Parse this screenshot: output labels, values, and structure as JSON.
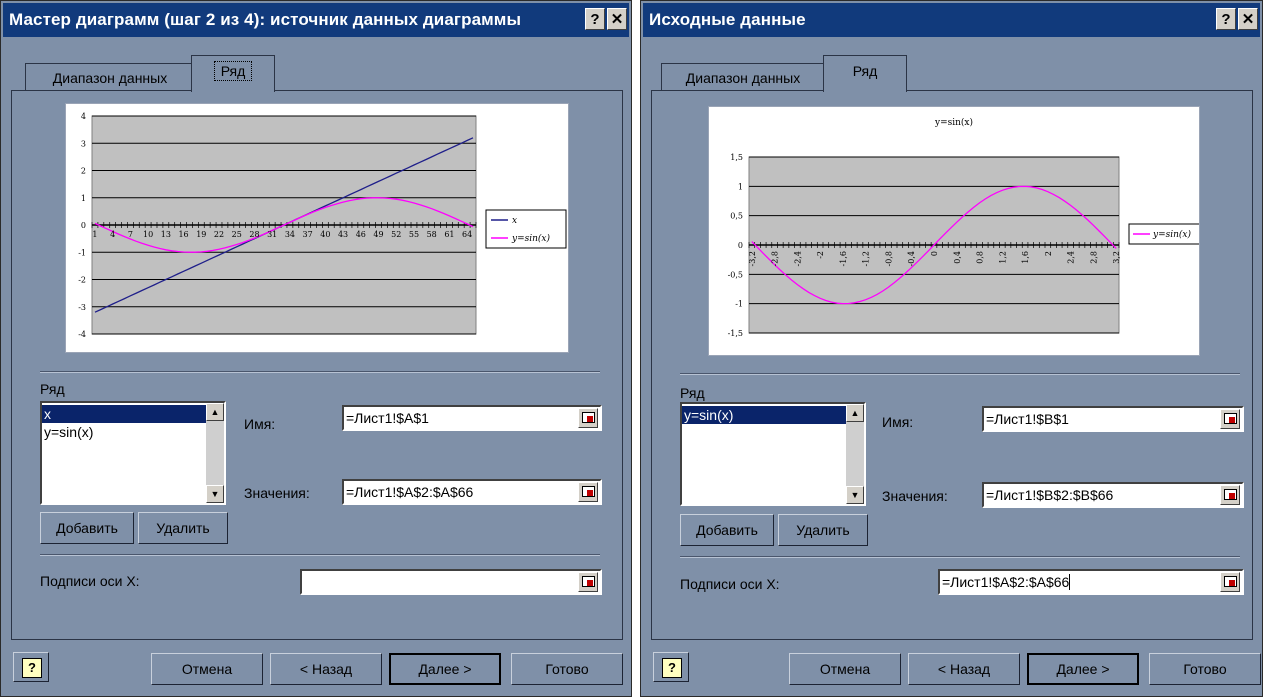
{
  "dialog1": {
    "title": "Мастер диаграмм (шаг 2 из 4): источник данных диаграммы",
    "help_glyph": "?",
    "close_glyph": "✕",
    "tabs": [
      {
        "label": "Диапазон данных"
      },
      {
        "label": "Ряд"
      }
    ],
    "series_group_label": "Ряд",
    "series_list": [
      "x",
      "y=sin(x)"
    ],
    "selected_series": "x",
    "name_label": "Имя:",
    "name_value": "=Лист1!$A$1",
    "values_label": "Значения:",
    "values_value": "=Лист1!$A$2:$A$66",
    "add_button": "Добавить",
    "delete_button": "Удалить",
    "xlabels_label": "Подписи оси X:",
    "xlabels_value": "",
    "help_button": "?",
    "cancel": "Отмена",
    "back": "< Назад",
    "next": "Далее >",
    "finish": "Готово"
  },
  "dialog2": {
    "title": "Исходные данные",
    "help_glyph": "?",
    "close_glyph": "✕",
    "tabs": [
      {
        "label": "Диапазон данных"
      },
      {
        "label": "Ряд"
      }
    ],
    "series_group_label": "Ряд",
    "series_list": [
      "y=sin(x)"
    ],
    "selected_series": "y=sin(x)",
    "name_label": "Имя:",
    "name_value": "=Лист1!$B$1",
    "values_label": "Значения:",
    "values_value": "=Лист1!$B$2:$B$66",
    "add_button": "Добавить",
    "delete_button": "Удалить",
    "xlabels_label": "Подписи оси X:",
    "xlabels_value": "=Лист1!$A$2:$A$66",
    "help_button": "?",
    "cancel": "Отмена",
    "back": "< Назад",
    "next": "Далее >",
    "finish": "Готово"
  },
  "chart_data": [
    {
      "type": "line",
      "title": "",
      "xlabel": "",
      "ylabel": "",
      "ylim": [
        -4,
        4
      ],
      "y_ticks": [
        "4",
        "3",
        "2",
        "1",
        "0",
        "-1",
        "-2",
        "-3",
        "-4"
      ],
      "categories": [
        "1",
        "4",
        "7",
        "10",
        "13",
        "16",
        "19",
        "22",
        "25",
        "28",
        "31",
        "34",
        "37",
        "40",
        "43",
        "46",
        "49",
        "52",
        "55",
        "58",
        "61",
        "64"
      ],
      "x_count": 65,
      "series": [
        {
          "name": "x",
          "color": "#1f1f8a",
          "start": -3.2,
          "step": 0.1
        },
        {
          "name": "y=sin(x)",
          "color": "#ff00ff",
          "function": "sin",
          "start": -3.2,
          "step": 0.1
        }
      ],
      "legend": "right",
      "grid": true,
      "plot_background": "#c0c0c0"
    },
    {
      "type": "line",
      "title": "y=sin(x)",
      "xlabel": "",
      "ylabel": "",
      "ylim": [
        -1.5,
        1.5
      ],
      "y_ticks": [
        "1,5",
        "1",
        "0,5",
        "0",
        "-0,5",
        "-1",
        "-1,5"
      ],
      "categories": [
        "-3,2",
        "-2,8",
        "-2,4",
        "-2",
        "-1,6",
        "-1,2",
        "-0,8",
        "-0,4",
        "0",
        "0,4",
        "0,8",
        "1,2",
        "1,6",
        "2",
        "2,4",
        "2,8",
        "3,2"
      ],
      "x_count": 65,
      "series": [
        {
          "name": "y=sin(x)",
          "color": "#ff00ff",
          "function": "sin",
          "start": -3.2,
          "step": 0.1
        }
      ],
      "legend": "right",
      "grid": true,
      "plot_background": "#c0c0c0"
    }
  ]
}
